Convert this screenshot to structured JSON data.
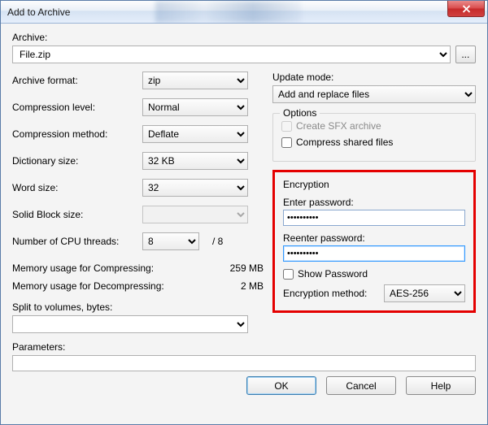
{
  "window": {
    "title": "Add to Archive"
  },
  "archive": {
    "label": "Archive:",
    "value": "File.zip",
    "browse": "..."
  },
  "left": {
    "format_label": "Archive format:",
    "format_value": "zip",
    "level_label": "Compression level:",
    "level_value": "Normal",
    "method_label": "Compression method:",
    "method_value": "Deflate",
    "dict_label": "Dictionary size:",
    "dict_value": "32 KB",
    "word_label": "Word size:",
    "word_value": "32",
    "solid_label": "Solid Block size:",
    "solid_value": "",
    "threads_label": "Number of CPU threads:",
    "threads_value": "8",
    "threads_total": "/ 8",
    "mem_comp_label": "Memory usage for Compressing:",
    "mem_comp_value": "259 MB",
    "mem_decomp_label": "Memory usage for Decompressing:",
    "mem_decomp_value": "2 MB",
    "split_label": "Split to volumes, bytes:",
    "split_value": ""
  },
  "right": {
    "update_label": "Update mode:",
    "update_value": "Add and replace files",
    "options_title": "Options",
    "sfx_label": "Create SFX archive",
    "shared_label": "Compress shared files"
  },
  "encryption": {
    "title": "Encryption",
    "enter_label": "Enter password:",
    "enter_value": "••••••••••",
    "reenter_label": "Reenter password:",
    "reenter_value": "••••••••••",
    "show_label": "Show Password",
    "method_label": "Encryption method:",
    "method_value": "AES-256"
  },
  "params": {
    "label": "Parameters:",
    "value": ""
  },
  "buttons": {
    "ok": "OK",
    "cancel": "Cancel",
    "help": "Help"
  }
}
